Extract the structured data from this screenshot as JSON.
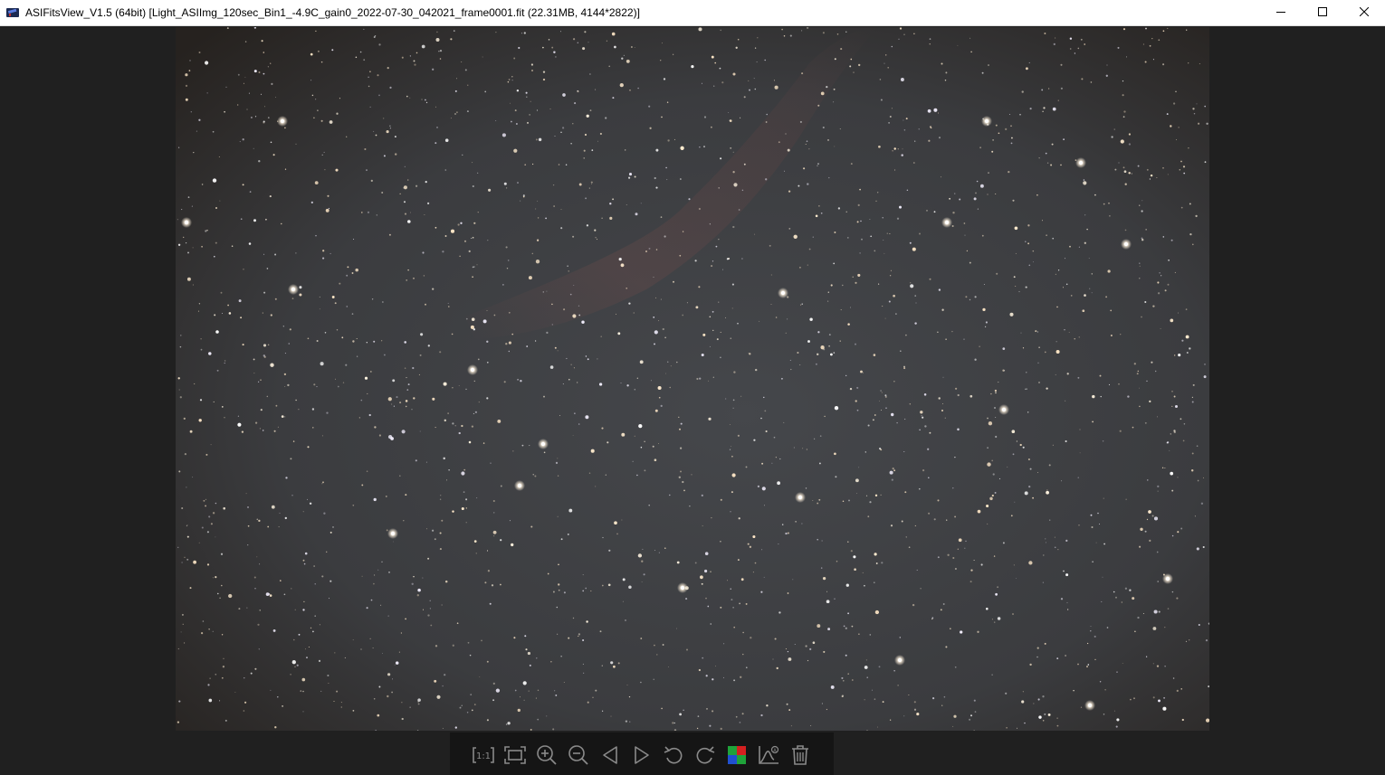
{
  "window": {
    "title": "ASIFitsView_V1.5 (64bit) [Light_ASIImg_120sec_Bin1_-4.9C_gain0_2022-07-30_042021_frame0001.fit (22.31MB, 4144*2822)]",
    "icon": "telescope-app-icon",
    "controls": [
      "minimize-icon",
      "maximize-icon",
      "close-icon"
    ]
  },
  "image": {
    "content": "star-field-astrophotograph",
    "background_color": "#3a3b3d"
  },
  "toolbar": {
    "buttons": [
      {
        "name": "actual-size",
        "icon": "one-to-one-icon",
        "glyph": "1:1"
      },
      {
        "name": "fit-window",
        "icon": "fit-screen-icon"
      },
      {
        "name": "zoom-in",
        "icon": "zoom-in-icon"
      },
      {
        "name": "zoom-out",
        "icon": "zoom-out-icon"
      },
      {
        "name": "previous",
        "icon": "triangle-left-icon"
      },
      {
        "name": "next",
        "icon": "triangle-right-icon"
      },
      {
        "name": "rotate-left",
        "icon": "rotate-ccw-icon"
      },
      {
        "name": "rotate-right",
        "icon": "rotate-cw-icon"
      },
      {
        "name": "debayer",
        "icon": "bayer-color-icon"
      },
      {
        "name": "stretch",
        "icon": "histogram-stretch-icon"
      },
      {
        "name": "delete",
        "icon": "trash-icon"
      }
    ],
    "colors": {
      "icon": "#8a8a8a",
      "bayer_red": "#d42020",
      "bayer_green": "#1fa33a",
      "bayer_blue": "#2050d0"
    }
  }
}
